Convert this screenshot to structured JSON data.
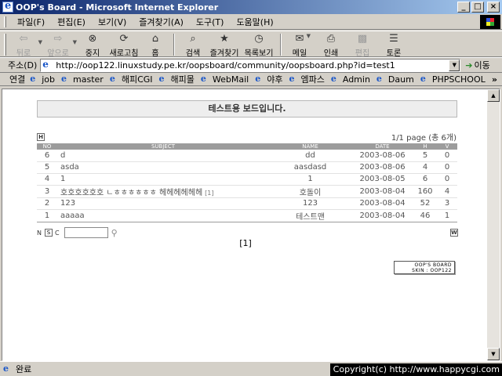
{
  "window": {
    "title": "OOP's Board - Microsoft Internet Explorer",
    "min": "_",
    "max": "□",
    "close": "×"
  },
  "menu": [
    "파일(F)",
    "편집(E)",
    "보기(V)",
    "즐겨찾기(A)",
    "도구(T)",
    "도움말(H)"
  ],
  "toolbar": {
    "back": "뒤로",
    "forward": "앞으로",
    "stop": "중지",
    "refresh": "새로고침",
    "home": "홈",
    "search": "검색",
    "favorites": "즐겨찾기",
    "history": "목록보기",
    "mail": "메일",
    "print": "인쇄",
    "edit": "편집",
    "discuss": "토론"
  },
  "icons": {
    "back": "⇦",
    "forward": "⇨",
    "stop": "⊗",
    "refresh": "⟳",
    "home": "⌂",
    "search": "⌕",
    "favorites": "★",
    "history": "◷",
    "mail": "✉",
    "print": "⎙",
    "edit": "▩",
    "discuss": "☰"
  },
  "address": {
    "label": "주소(D)",
    "url": "http://oop122.linuxstudy.pe.kr/oopsboard/community/oopsboard.php?id=test1",
    "go": "이동"
  },
  "links": {
    "label": "연결",
    "items": [
      "job",
      "master",
      "해피CGI",
      "해피몰",
      "WebMail",
      "야후",
      "엠파스",
      "Admin",
      "Daum",
      "PHPSCHOOL"
    ],
    "more": "»"
  },
  "board": {
    "banner": "테스트용 보드입니다.",
    "page_info": "1/1 page (총 6개)",
    "head_button": "H",
    "foot_button": "W",
    "columns": [
      "NO",
      "SUBJECT",
      "NAME",
      "DATE",
      "H",
      "V"
    ],
    "rows": [
      {
        "no": "6",
        "subject": "d",
        "comments": "",
        "name": "dd",
        "date": "2003-08-06",
        "hits": "5",
        "votes": "0"
      },
      {
        "no": "5",
        "subject": "asda",
        "comments": "",
        "name": "aasdasd",
        "date": "2003-08-06",
        "hits": "4",
        "votes": "0"
      },
      {
        "no": "4",
        "subject": "1",
        "comments": "",
        "name": "1",
        "date": "2003-08-05",
        "hits": "6",
        "votes": "0"
      },
      {
        "no": "3",
        "subject": "호호호호호호 ㄴㅎㅎㅎㅎㅎㅎ 헤헤헤헤헤헤",
        "comments": "[1]",
        "name": "호돌이",
        "date": "2003-08-04",
        "hits": "160",
        "votes": "4"
      },
      {
        "no": "2",
        "subject": "123",
        "comments": "",
        "name": "123",
        "date": "2003-08-04",
        "hits": "52",
        "votes": "3"
      },
      {
        "no": "1",
        "subject": "aaaaa",
        "comments": "",
        "name": "테스트맨",
        "date": "2003-08-04",
        "hits": "46",
        "votes": "1"
      }
    ],
    "search_opts": [
      "N",
      "S",
      "C"
    ],
    "search_value": "",
    "search_icon": "⚲",
    "pager": "[1]",
    "skin_line1": "OOP'S BOARD",
    "skin_line2": "SKIN : OOP122"
  },
  "status": {
    "text": "완료",
    "copyright": "Copyright(c) http://www.happycgi.com"
  }
}
